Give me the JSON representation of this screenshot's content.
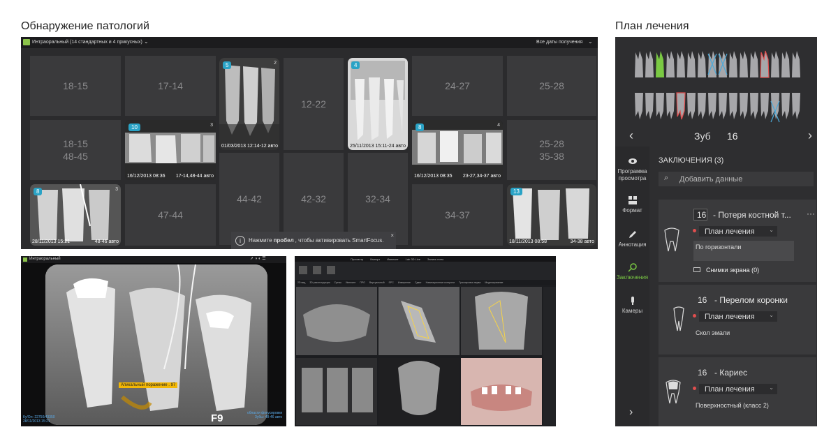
{
  "headings": {
    "pathology": "Обнаружение патологий",
    "plan": "План лечения"
  },
  "pathology": {
    "dropdown_label": "Интраоральный (14 стандартных и 4 прикусных)",
    "dates_filter": "Все даты получения",
    "tiles": {
      "t1815": "18-15",
      "t1714": "17-14",
      "t1222": "12-22",
      "t2427": "24-27",
      "t2528": "25-28",
      "t1815b_1": "18-15",
      "t1815b_2": "48-45",
      "t2528b_1": "25-28",
      "t2528b_2": "35-38",
      "t4744": "47-44",
      "t4442": "44-42",
      "t4232": "42-32",
      "t3234": "32-34",
      "t3437": "34-37"
    },
    "images": [
      {
        "badge": "5",
        "count": "2",
        "date": "01/03/2013 12:14-12 авто",
        "extra": ""
      },
      {
        "badge": "4",
        "count": "",
        "date": "25/11/2013 15:11-24 авто",
        "extra": ""
      },
      {
        "badge": "10",
        "count": "3",
        "date": "16/12/2013 08:36",
        "extra": "17-14,48-44 авто"
      },
      {
        "badge": "8",
        "count": "4",
        "date": "16/12/2013 08:35",
        "extra": "23-27,34-37 авто"
      },
      {
        "badge": "8",
        "count": "3",
        "date": "28/11/2013 15:21",
        "extra": "48-46 авто"
      },
      {
        "badge": "13",
        "count": "",
        "date": "18/11/2013 08:58",
        "extra": "34-38 авто"
      }
    ],
    "toast": {
      "pre": "Нажмите ",
      "key": "пробел",
      "post": ", чтобы активировать SmartFocus."
    }
  },
  "viewer1": {
    "mode": "Интраоральный",
    "finding_label": "Апикальный поражение . 97",
    "label_f": "F9",
    "footer_left_1": "Ку/Ол: 22750/43350",
    "footer_left_2": "28/11/2013 15:21",
    "footer_right_1": "области фокусировки",
    "footer_right_2": "Зубы: 48-46 авто"
  },
  "viewer2": {
    "tabs": [
      "Просмотр",
      "Импорт",
      "Имплант",
      "Lab 3D Live",
      "Запись ноты"
    ],
    "subtabs": [
      "2D вид",
      "3D реконструкция",
      "Срезы",
      "Имплант",
      "ПРО",
      "Виртуальный",
      "SPC",
      "Измерение",
      "Сдвиг",
      "Навигационные контроли",
      "Трассировка нерва",
      "Моделирование"
    ]
  },
  "plan": {
    "tooth_label": "Зуб",
    "tooth_number": "16",
    "sidebar": [
      {
        "icon": "eye-icon",
        "label": "Программа просмотра"
      },
      {
        "icon": "layout-icon",
        "label": "Формат"
      },
      {
        "icon": "pencil-icon",
        "label": "Аннотация"
      },
      {
        "icon": "findings-icon",
        "label": "Заключения"
      },
      {
        "icon": "camera-icon",
        "label": "Камеры"
      }
    ],
    "conclusions_title": "ЗАКЛЮЧЕНИЯ (3)",
    "search_placeholder": "Добавить данные",
    "cards": [
      {
        "number": "16",
        "title": "- Потеря костной т...",
        "status": "План лечения",
        "note": "По горизонтали",
        "screens": "Снимки экрана (0)"
      },
      {
        "number": "16",
        "title": "- Перелом коронки",
        "status": "План лечения",
        "note": "Скол эмали"
      },
      {
        "number": "16",
        "title": "- Кариес",
        "status": "План лечения",
        "note": "Поверхностный (класс 2)"
      }
    ],
    "colors": {
      "accent": "#7ac943",
      "danger": "#e04e4e",
      "cross": "#4aa8d8"
    }
  }
}
